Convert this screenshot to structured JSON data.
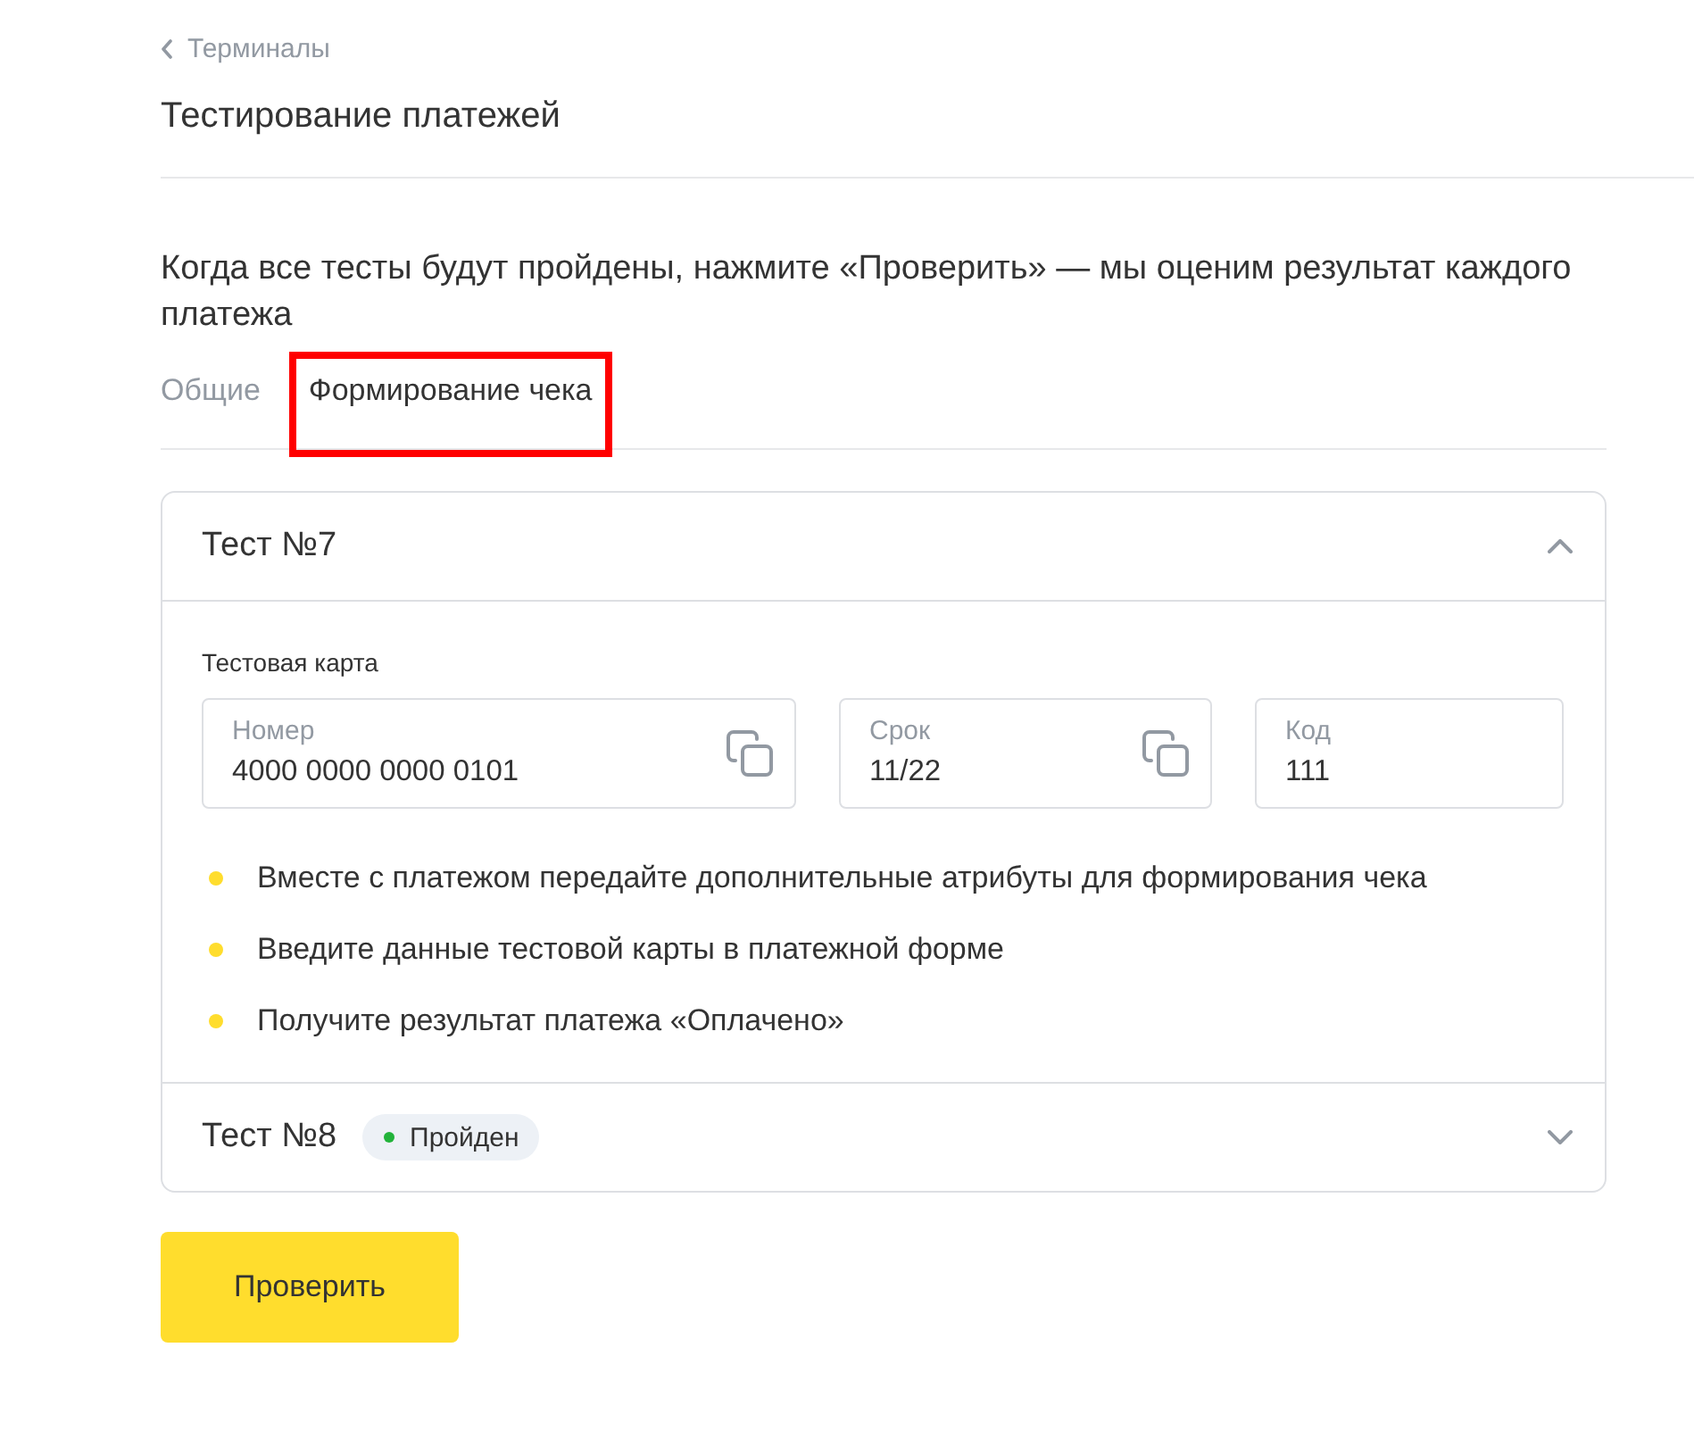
{
  "breadcrumb": {
    "label": "Терминалы"
  },
  "title": "Тестирование платежей",
  "description": "Когда все тесты будут пройдены, нажмите «Проверить» — мы оценим результат каждого платежа",
  "tabs": [
    {
      "label": "Общие",
      "selected": false,
      "highlighted": false
    },
    {
      "label": "Формирование чека",
      "selected": true,
      "highlighted": true
    }
  ],
  "tests": [
    {
      "title": "Тест №7",
      "expanded": true,
      "card": {
        "label": "Тестовая карта",
        "fields": [
          {
            "label": "Номер",
            "value": "4000 0000 0000 0101",
            "copyable": true
          },
          {
            "label": "Срок",
            "value": "11/22",
            "copyable": true
          },
          {
            "label": "Код",
            "value": "111",
            "copyable": false
          }
        ]
      },
      "steps": [
        "Вместе с платежом передайте дополнительные атрибуты для формирования чека",
        "Введите данные тестовой карты в платежной форме",
        "Получите результат платежа «Оплачено»"
      ]
    },
    {
      "title": "Тест №8",
      "expanded": false,
      "status": {
        "label": "Пройден",
        "color": "#22b33a"
      }
    }
  ],
  "submit_button": "Проверить"
}
